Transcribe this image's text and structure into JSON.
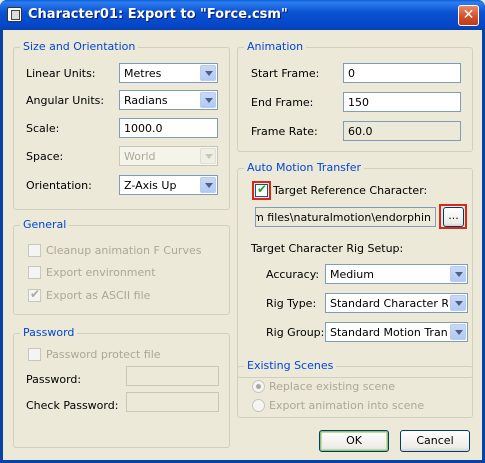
{
  "window": {
    "title": "Character01: Export to \"Force.csm\"",
    "close_glyph": "✕",
    "accent": "#0046D5",
    "highlight": "#D9271E"
  },
  "size_orientation": {
    "title": "Size and Orientation",
    "linear_units": {
      "label": "Linear Units:",
      "value": "Metres"
    },
    "angular_units": {
      "label": "Angular Units:",
      "value": "Radians"
    },
    "scale": {
      "label": "Scale:",
      "value": "1000.0"
    },
    "space": {
      "label": "Space:",
      "value": "World"
    },
    "orientation": {
      "label": "Orientation:",
      "value": "Z-Axis Up"
    }
  },
  "general": {
    "title": "General",
    "cleanup": "Cleanup animation F Curves",
    "export_env": "Export environment",
    "export_ascii": "Export as ASCII file"
  },
  "password": {
    "title": "Password",
    "protect": "Password protect file",
    "password_label": "Password:",
    "check_label": "Check Password:"
  },
  "animation": {
    "title": "Animation",
    "start": {
      "label": "Start Frame:",
      "value": "0"
    },
    "end": {
      "label": "End Frame:",
      "value": "150"
    },
    "rate": {
      "label": "Frame Rate:",
      "value": "60.0"
    }
  },
  "amt": {
    "title": "Auto Motion Transfer",
    "target_ref_label": "Target Reference Character:",
    "path": "c:\\program files\\naturalmotion\\endorphin",
    "browse": "...",
    "rig_setup_label": "Target Character Rig Setup:",
    "accuracy": {
      "label": "Accuracy:",
      "value": "Medium"
    },
    "rig_type": {
      "label": "Rig Type:",
      "value": "Standard Character Rig"
    },
    "rig_group": {
      "label": "Rig Group:",
      "value": "Standard Motion Transfer"
    }
  },
  "scenes": {
    "title": "Existing Scenes",
    "replace": "Replace existing scene",
    "export_into": "Export animation into scene"
  },
  "buttons": {
    "ok": "OK",
    "cancel": "Cancel"
  }
}
